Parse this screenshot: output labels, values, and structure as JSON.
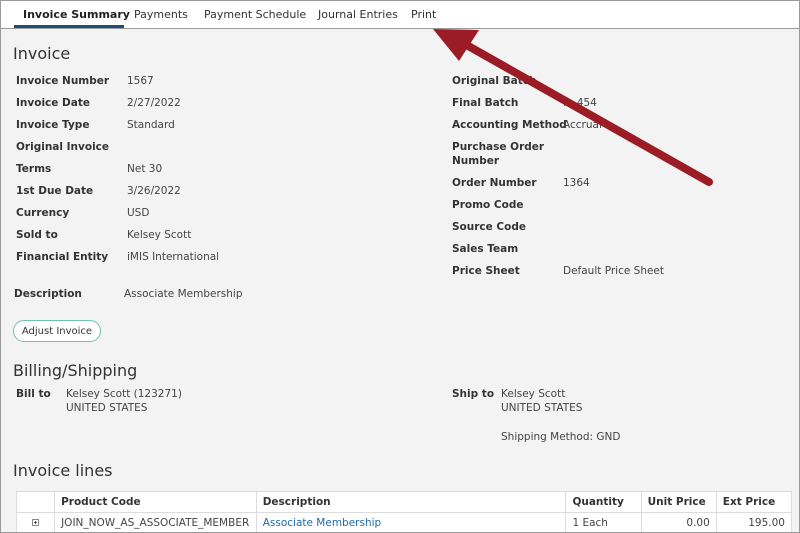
{
  "tabs": [
    "Invoice Summary",
    "Payments",
    "Payment Schedule",
    "Journal Entries",
    "Print"
  ],
  "invoice": {
    "title": "Invoice",
    "left": [
      {
        "label": "Invoice Number",
        "value": "1567"
      },
      {
        "label": "Invoice Date",
        "value": "2/27/2022"
      },
      {
        "label": "Invoice Type",
        "value": "Standard"
      },
      {
        "label": "Original Invoice",
        "value": ""
      },
      {
        "label": "Terms",
        "value": "Net 30"
      },
      {
        "label": "1st Due Date",
        "value": "3/26/2022"
      },
      {
        "label": "Currency",
        "value": "USD"
      },
      {
        "label": "Sold to",
        "value": "Kelsey Scott"
      },
      {
        "label": "Financial Entity",
        "value": "iMIS International"
      }
    ],
    "right": [
      {
        "label": "Original Batch",
        "value": ""
      },
      {
        "label": "Final Batch",
        "value": "...-454"
      },
      {
        "label": "Accounting Method",
        "value": "Accrual"
      },
      {
        "label": "Purchase Order",
        "label2": "Number",
        "value": ""
      },
      {
        "label": "Order Number",
        "value": "1364"
      },
      {
        "label": "Promo Code",
        "value": ""
      },
      {
        "label": "Source Code",
        "value": ""
      },
      {
        "label": "Sales Team",
        "value": ""
      },
      {
        "label": "Price Sheet",
        "value": "Default Price Sheet"
      }
    ],
    "description_label": "Description",
    "description_value": "Associate Membership",
    "adjust_button": "Adjust Invoice"
  },
  "billing": {
    "title": "Billing/Shipping",
    "bill_to_label": "Bill to",
    "bill_to_name": "Kelsey Scott (123271)",
    "bill_to_country": "UNITED STATES",
    "ship_to_label": "Ship to",
    "ship_to_name": "Kelsey Scott",
    "ship_to_country": "UNITED STATES",
    "shipping_method": "Shipping Method: GND"
  },
  "lines": {
    "title": "Invoice lines",
    "headers": [
      "Product Code",
      "Description",
      "Quantity",
      "Unit Price",
      "Ext Price"
    ],
    "rows": [
      {
        "code": "JOIN_NOW_AS_ASSOCIATE_MEMBER",
        "description": "Associate Membership",
        "quantity": "1 Each",
        "unit_price": "0.00",
        "ext_price": "195.00"
      }
    ]
  },
  "colors": {
    "arrow": "#9b1c24",
    "tab_underline": "#1f4e79",
    "button_border": "#6cc3ae",
    "link": "#1e6aa8"
  }
}
